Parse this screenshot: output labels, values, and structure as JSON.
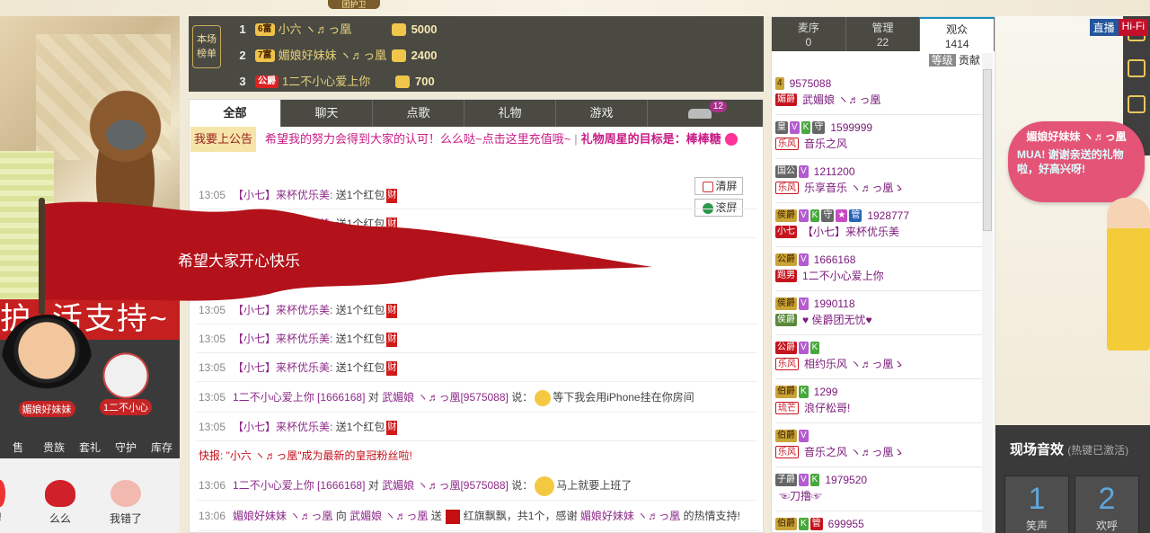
{
  "video": {
    "badge_live": "直播",
    "badge_hifi": "Hi-Fi"
  },
  "left_banner": {
    "text": "护~活支持~"
  },
  "cards": [
    {
      "name": "媚娘好妹妹"
    },
    {
      "name": "1二不小心"
    }
  ],
  "left_tabs": [
    "售",
    "贵族",
    "套礼",
    "守护",
    "库存"
  ],
  "left_gifts": [
    {
      "label": "!"
    },
    {
      "label": "么么"
    },
    {
      "label": "我错了"
    }
  ],
  "guard_button": "团护卫",
  "rank": {
    "title": "本场榜单",
    "rows": [
      {
        "no": "1",
        "level": "6富",
        "name": "小六 ヽ♬っ凰",
        "points": "5000"
      },
      {
        "no": "2",
        "level": "7富",
        "name": "媚娘好妹妹 ヽ♬っ凰",
        "points": "2400"
      },
      {
        "no": "3",
        "level": "公爵",
        "name": "1二不小心爱上你",
        "points": "700"
      }
    ]
  },
  "chat_tabs": [
    "全部",
    "聊天",
    "点歌",
    "礼物",
    "游戏",
    ""
  ],
  "chat_tabs_badge": "12",
  "notice": {
    "post_button": "我要上公告",
    "message": "希望我的努力会得到大家的认可！么么哒~点击这里充值哦~",
    "separator": "|",
    "target": "礼物周星的目标是：棒棒糖"
  },
  "chat_buttons": {
    "clear": "清屏",
    "scroll": "滚屏"
  },
  "flag_text": "希望大家开心快乐",
  "messages": [
    {
      "time": "13:05",
      "user": "【小七】来杯优乐美",
      "text": ": 送1个红包",
      "cai": "财"
    },
    {
      "time": "13:05",
      "user": "【小七】来杯优乐美",
      "text": ": 送1个红包",
      "cai": "财"
    },
    {
      "time": "13:05",
      "user": "【小七】来杯优乐美",
      "text": ": 送1个红包",
      "cai": "财"
    },
    {
      "time": "13:05",
      "user": "【小七】来杯优乐美",
      "text": ": 送1个红包",
      "cai": "财"
    },
    {
      "time": "13:05",
      "user": "【小七】来杯优乐美",
      "text": ": 送1个红包",
      "cai": "财"
    },
    {
      "time": "13:05",
      "user": "1二不小心爱上你 [1666168]",
      "mid": "对",
      "user2": "武媚娘 ヽ♬っ凰[9575088]",
      "text": "说：",
      "text2": "等下我会用iPhone挂在你房间"
    },
    {
      "time": "13:05",
      "user": "【小七】来杯优乐美",
      "text": ": 送1个红包",
      "cai": "财"
    },
    {
      "flash": "快报: \"小六 ヽ♬っ凰\"成为最新的皇冠粉丝啦!"
    },
    {
      "time": "13:06",
      "user": "1二不小心爱上你 [1666168]",
      "mid": "对",
      "user2": "武媚娘 ヽ♬っ凰[9575088]",
      "text": "说：",
      "text2": "马上就要上班了"
    },
    {
      "time": "13:06",
      "user": "媚娘好妹妹 ヽ♬っ凰",
      "mid": "向",
      "user2": "武媚娘 ヽ♬っ凰",
      "text": "送",
      "text2": "红旗飘飘，共1个，感谢",
      "user3": "媚娘好妹妹 ヽ♬っ凰",
      "text3": "的热情支持!"
    }
  ],
  "userlist": {
    "tabs": [
      {
        "label": "麦序",
        "count": "0"
      },
      {
        "label": "管理",
        "count": "22"
      },
      {
        "label": "观众",
        "count": "1414"
      }
    ],
    "head_level": "等级",
    "head_contrib": "贡献",
    "users": [
      {
        "tags": [
          "4"
        ],
        "id": "9575088",
        "badge": "媚爵",
        "name": "武媚娘 ヽ♬っ凰"
      },
      {
        "tags": [
          "皇",
          "V",
          "K",
          "守"
        ],
        "id": "1599999",
        "badge": "乐风",
        "name": "音乐之风"
      },
      {
        "tags": [
          "国公",
          "V"
        ],
        "id": "1211200",
        "badge": "乐风",
        "name": "乐享音乐 ヽ♬っ凰ゝ"
      },
      {
        "tags": [
          "侯爵",
          "V",
          "K",
          "守",
          "★",
          "管"
        ],
        "id": "1928777",
        "badge": "小七",
        "name": "【小七】来杯优乐美"
      },
      {
        "tags": [
          "公爵",
          "V"
        ],
        "id": "1666168",
        "badge": "跑男",
        "name": "1二不小心爱上你"
      },
      {
        "tags": [
          "侯爵",
          "V"
        ],
        "id": "1990118",
        "badge": "侯爵",
        "name": "♥ 侯爵团无忧♥"
      },
      {
        "tags": [
          "公爵",
          "V",
          "K"
        ],
        "id": "",
        "badge": "乐风",
        "name": "相约乐风 ヽ♬っ凰ゝ"
      },
      {
        "tags": [
          "伯爵",
          "K"
        ],
        "id": "1299",
        "badge": "琉芒",
        "name": "浪仔松哥!"
      },
      {
        "tags": [
          "伯爵",
          "V"
        ],
        "id": "",
        "badge": "乐风",
        "name": "音乐之风 ヽ♬っ凰ゝ"
      },
      {
        "tags": [
          "子爵",
          "V",
          "K"
        ],
        "id": "1979520",
        "badge": "",
        "name": "☜刀撸☞"
      },
      {
        "tags": [
          "伯爵",
          "K",
          "管"
        ],
        "id": "699955",
        "badge": "",
        "name": ""
      }
    ]
  },
  "bubble": {
    "name": "媚娘好妹妹 ヽ♬っ凰",
    "text": "MUA! 谢谢亲送的礼物啦，好高兴呀!"
  },
  "sound": {
    "title": "现场音效",
    "hint": "(热键已激活)",
    "items": [
      {
        "no": "1",
        "label": "笑声"
      },
      {
        "no": "2",
        "label": "欢呼"
      }
    ]
  },
  "colors": {
    "accent": "#c81b86",
    "dark": "#4a4a42",
    "red": "#c51f1f"
  }
}
